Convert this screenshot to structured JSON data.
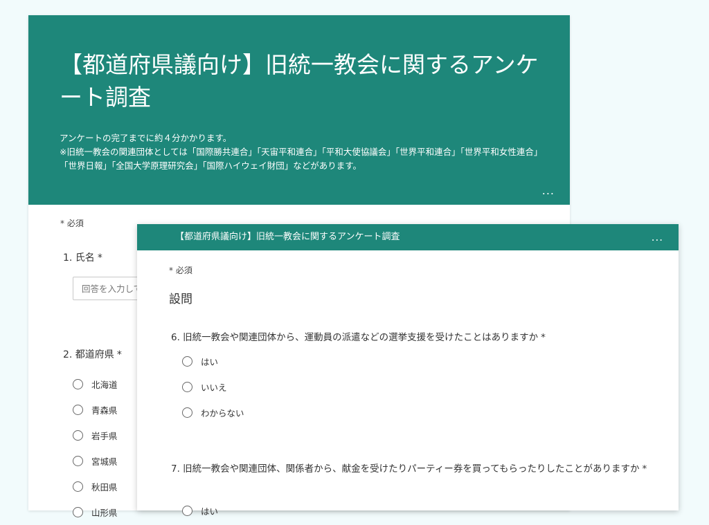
{
  "back_form": {
    "title": "【都道府県議向け】旧統一教会に関するアンケート調査",
    "description_line1": "アンケートの完了までに約４分かかります。",
    "description_line2": "※旧統一教会の関連団体としては「国際勝共連合」「天宙平和連合」「平和大使協議会」「世界平和連合」「世界平和女性連合」「世界日報」「全国大学原理研究会」「国際ハイウェイ財団」などがあります。",
    "more": "...",
    "required_note": "* 必須",
    "q1": {
      "label": "1. 氏名",
      "required": "*",
      "placeholder": "回答を入力してください"
    },
    "q2": {
      "label": "2. 都道府県",
      "required": "*",
      "options": [
        "北海道",
        "青森県",
        "岩手県",
        "宮城県",
        "秋田県",
        "山形県"
      ]
    }
  },
  "front_form": {
    "title": "【都道府県議向け】旧統一教会に関するアンケート調査",
    "more": "...",
    "required_note": "* 必須",
    "section_title": "設問",
    "q6": {
      "label": "6. 旧統一教会や関連団体から、運動員の派遣などの選挙支援を受けたことはありますか",
      "required": "*",
      "options": [
        "はい",
        "いいえ",
        "わからない"
      ]
    },
    "q7": {
      "label": "7. 旧統一教会や関連団体、関係者から、献金を受けたりパーティー券を買ってもらったりしたことがありますか",
      "required": "*",
      "options": [
        "はい"
      ]
    }
  },
  "colors": {
    "header": "#1e877a",
    "background": "#f2fbfc"
  }
}
